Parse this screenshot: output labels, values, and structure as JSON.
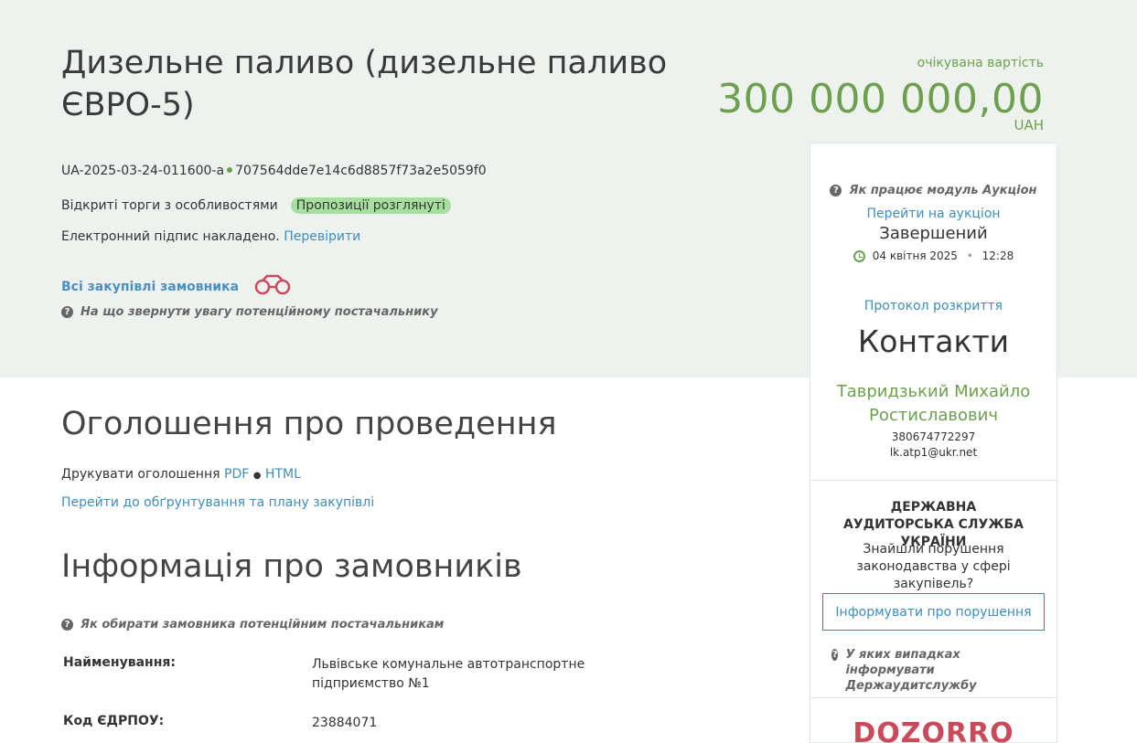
{
  "header": {
    "title": "Дизельне паливо (дизельне паливо ЄВРО-5)",
    "price_label": "очікувана вартість",
    "price_value": "300 000 000,00",
    "price_currency": "UAH",
    "tender_id": "UA-2025-03-24-011600-a",
    "tender_hash": "707564dde7e14c6d8857f73a2e5059f0",
    "procedure_type": "Відкриті торги з особливостями",
    "status": "Пропозиції розглянуті",
    "signature_text": "Електронний підпис накладено.",
    "verify_link": "Перевірити",
    "all_procurements_link": "Всі закупівлі замовника",
    "supplier_hint": "На що звернути увагу потенційному постачальнику"
  },
  "announcement": {
    "title": "Оголошення про проведення",
    "print_label": "Друкувати оголошення",
    "pdf_link": "PDF",
    "separator": "●",
    "html_link": "HTML",
    "plan_link": "Перейти до обґрунтування та плану закупівлі"
  },
  "customers": {
    "title": "Інформація про замовників",
    "hint": "Як обирати замовника потенційним постачальникам",
    "rows": [
      {
        "label": "Найменування:",
        "value": "Львівське комунальне автотранспортне підприємство №1"
      },
      {
        "label": "Код ЄДРПОУ:",
        "value": "23884071"
      }
    ]
  },
  "sidebar": {
    "auction_hint": "Як працює модуль Аукціон",
    "auction_link": "Перейти на аукціон",
    "auction_status": "Завершений",
    "auction_date": "04 квітня 2025",
    "auction_time": "12:28",
    "protocol_link": "Протокол розкриття",
    "contacts_title": "Контакти",
    "contact_name": "Тавридзький Михайло Ростиславович",
    "contact_phone": "380674772297",
    "contact_email": "lk.atp1@ukr.net",
    "audit_title": "ДЕРЖАВНА АУДИТОРСЬКА СЛУЖБА УКРАЇНИ",
    "audit_question": "Знайшли порушення законодавства у сфері закупівель?",
    "inform_button": "Інформувати про порушення",
    "audit_hint": "У яких випадках інформувати Держаудитслужбу",
    "logo_text": "DOZORRO"
  },
  "colors": {
    "hero_bg": "#eef2ee",
    "accent_green": "#6ca04e",
    "link_blue": "#3c8dbc",
    "badge_green": "#a8dea0",
    "dozorro_red": "#c94a5a"
  },
  "icons": [
    "question-icon",
    "binoculars-icon",
    "clock-icon"
  ]
}
